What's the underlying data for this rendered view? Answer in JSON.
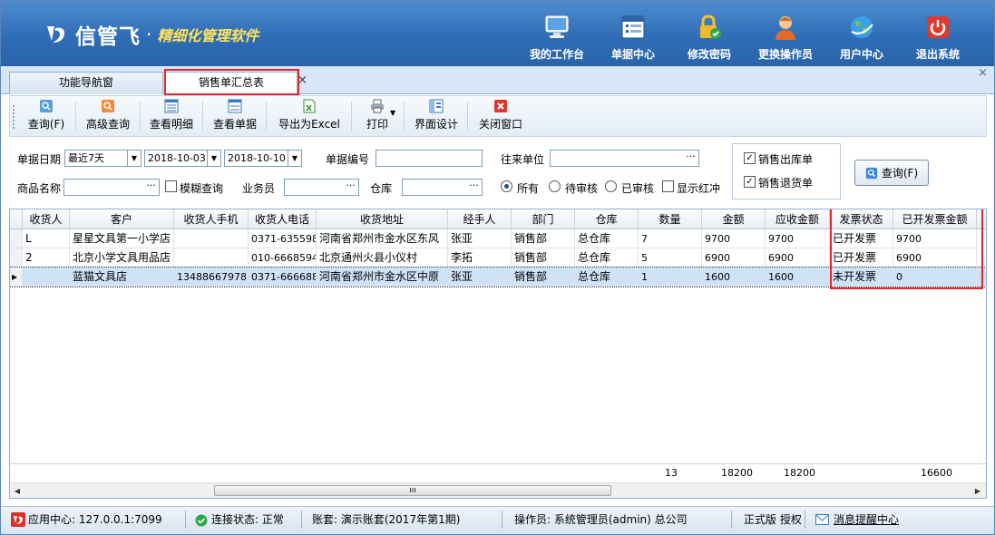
{
  "header": {
    "brand_name": "信管飞",
    "brand_dot": "·",
    "slogan": "精细化管理软件",
    "nav": [
      {
        "label": "我的工作台",
        "icon": "monitor-icon"
      },
      {
        "label": "单据中心",
        "icon": "document-list-icon"
      },
      {
        "label": "修改密码",
        "icon": "lock-icon"
      },
      {
        "label": "更换操作员",
        "icon": "user-icon"
      },
      {
        "label": "用户中心",
        "icon": "globe-icon"
      },
      {
        "label": "退出系统",
        "icon": "power-icon"
      }
    ]
  },
  "tabs": [
    {
      "label": "功能导航窗"
    },
    {
      "label": "销售单汇总表",
      "close": "×"
    }
  ],
  "window_close": "×",
  "toolbar": {
    "buttons": [
      {
        "label": "查询(F)",
        "icon": "search-icon"
      },
      {
        "label": "高级查询",
        "icon": "advanced-search-icon"
      },
      {
        "label": "查看明细",
        "icon": "detail-icon"
      },
      {
        "label": "查看单据",
        "icon": "view-document-icon"
      },
      {
        "label": "导出为Excel",
        "icon": "excel-icon"
      },
      {
        "label": "打印",
        "icon": "printer-icon"
      },
      {
        "label": "界面设计",
        "icon": "layout-icon"
      },
      {
        "label": "关闭窗口",
        "icon": "close-window-icon"
      }
    ]
  },
  "filters": {
    "date_label": "单据日期",
    "date_range": "最近7天",
    "date_from": "2018-10-03",
    "date_to": "2018-10-10",
    "doc_no_label": "单据编号",
    "doc_no_value": "",
    "partner_label": "往来单位",
    "partner_value": "",
    "ellipsis": "···",
    "product_label": "商品名称",
    "product_value": "",
    "fuzzy_label": "模糊查询",
    "salesman_label": "业务员",
    "salesman_value": "",
    "warehouse_label": "仓库",
    "warehouse_value": "",
    "status_options": [
      "所有",
      "待审核",
      "已审核"
    ],
    "show_red_label": "显示红冲",
    "check_sales_out": "销售出库单",
    "check_sales_return": "销售退货单",
    "query_button": "查询(F)"
  },
  "table": {
    "columns": [
      "收货人",
      "客户",
      "收货人手机",
      "收货人电话",
      "收货地址",
      "经手人",
      "部门",
      "仓库",
      "数量",
      "金额",
      "应收金额",
      "发票状态",
      "已开发票金额"
    ],
    "rows": [
      {
        "indicator": "",
        "receiver": "L",
        "customer": "星星文具第一小学店",
        "mobile": "",
        "phone": "0371-635598",
        "address": "河南省郑州市金水区东风",
        "handler": "张亚",
        "dept": "销售部",
        "warehouse": "总仓库",
        "qty": "7",
        "amount": "9700",
        "receivable": "9700",
        "invoice_status": "已开发票",
        "invoiced_amount": "9700"
      },
      {
        "indicator": "",
        "receiver": "2",
        "customer": "北京小学文具用品店",
        "mobile": "",
        "phone": "010-6668594",
        "address": "北京通州火县小仪村",
        "handler": "李拓",
        "dept": "销售部",
        "warehouse": "总仓库",
        "qty": "5",
        "amount": "6900",
        "receivable": "6900",
        "invoice_status": "已开发票",
        "invoiced_amount": "6900"
      },
      {
        "indicator": "▸",
        "receiver": "",
        "customer": "蓝猫文具店",
        "mobile": "13488667978",
        "phone": "0371-666688",
        "address": "河南省郑州市金水区中原",
        "handler": "张亚",
        "dept": "销售部",
        "warehouse": "总仓库",
        "qty": "1",
        "amount": "1600",
        "receivable": "1600",
        "invoice_status": "未开发票",
        "invoiced_amount": "0"
      }
    ],
    "totals": {
      "qty": "13",
      "amount": "18200",
      "receivable": "18200",
      "invoiced_amount": "16600"
    },
    "scroll_thumb": "ııı"
  },
  "statusbar": {
    "app_center": "应用中心: 127.0.0.1:7099",
    "connection": "连接状态: 正常",
    "account": "账套: 演示账套(2017年第1期)",
    "operator": "操作员: 系统管理员(admin) 总公司",
    "edition": "正式版 授权",
    "messages": "消息提醒中心"
  },
  "colors": {
    "header": "#2f6db6",
    "accent": "#e8252a",
    "selected_row": "#cfe3f8"
  }
}
